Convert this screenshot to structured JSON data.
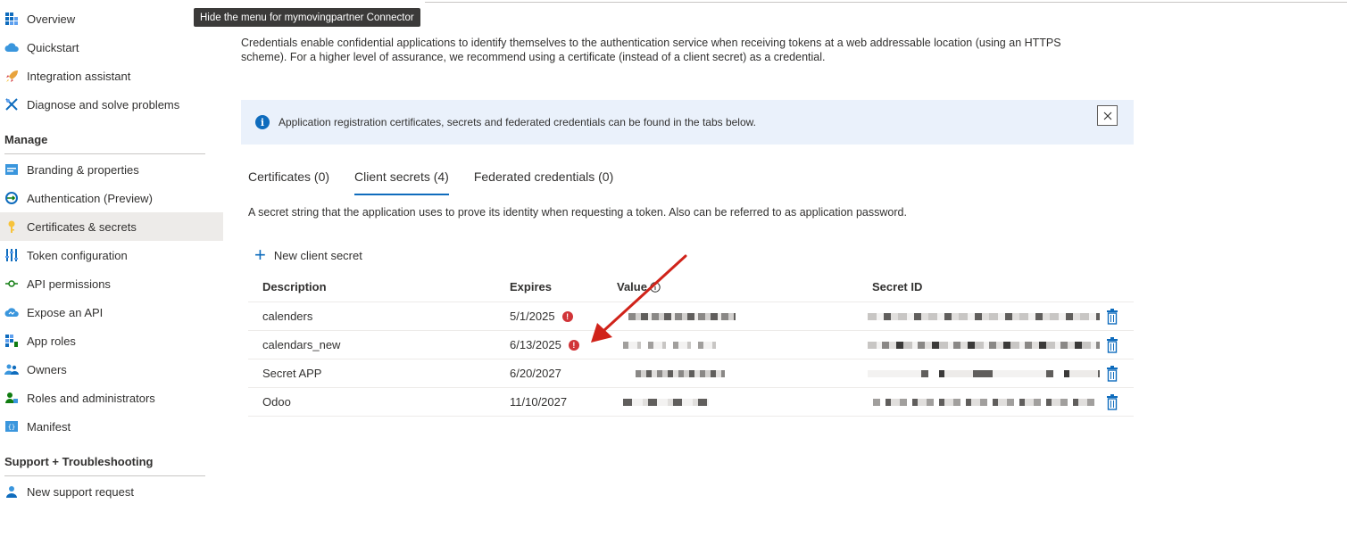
{
  "tooltip": "Hide the menu for mymovingpartner Connector",
  "sidebar": {
    "top_items": [
      {
        "label": "Overview",
        "icon": "overview-grid-icon"
      },
      {
        "label": "Quickstart",
        "icon": "quickstart-cloud-icon"
      },
      {
        "label": "Integration assistant",
        "icon": "rocket-icon"
      },
      {
        "label": "Diagnose and solve problems",
        "icon": "wrench-icon"
      }
    ],
    "manage_heading": "Manage",
    "manage_items": [
      {
        "label": "Branding & properties",
        "icon": "branding-icon"
      },
      {
        "label": "Authentication (Preview)",
        "icon": "authentication-icon"
      },
      {
        "label": "Certificates & secrets",
        "icon": "key-icon",
        "active": true
      },
      {
        "label": "Token configuration",
        "icon": "token-config-icon"
      },
      {
        "label": "API permissions",
        "icon": "api-permissions-icon"
      },
      {
        "label": "Expose an API",
        "icon": "expose-api-cloud-icon"
      },
      {
        "label": "App roles",
        "icon": "app-roles-grid-icon"
      },
      {
        "label": "Owners",
        "icon": "owners-icon"
      },
      {
        "label": "Roles and administrators",
        "icon": "roles-admin-icon"
      },
      {
        "label": "Manifest",
        "icon": "manifest-icon"
      }
    ],
    "support_heading": "Support + Troubleshooting",
    "support_items": [
      {
        "label": "New support request",
        "icon": "support-person-icon"
      }
    ]
  },
  "main": {
    "intro": "Credentials enable confidential applications to identify themselves to the authentication service when receiving tokens at a web addressable location (using an HTTPS scheme). For a higher level of assurance, we recommend using a certificate (instead of a client secret) as a credential.",
    "info_text": "Application registration certificates, secrets and federated credentials can be found in the tabs below.",
    "tabs": [
      {
        "label": "Certificates (0)",
        "active": false
      },
      {
        "label": "Client secrets (4)",
        "active": true
      },
      {
        "label": "Federated credentials (0)",
        "active": false
      }
    ],
    "tab_description": "A secret string that the application uses to prove its identity when requesting a token. Also can be referred to as application password.",
    "new_secret_label": "New client secret",
    "table": {
      "headers": {
        "description": "Description",
        "expires": "Expires",
        "value": "Value",
        "secret_id": "Secret ID"
      },
      "rows": [
        {
          "description": "calenders",
          "expires": "5/1/2025",
          "expired": true
        },
        {
          "description": "calendars_new",
          "expires": "6/13/2025",
          "expired": true
        },
        {
          "description": "Secret APP",
          "expires": "6/20/2027",
          "expired": false
        },
        {
          "description": "Odoo",
          "expires": "11/10/2027",
          "expired": false
        }
      ]
    }
  },
  "colors": {
    "accent": "#0f6cbd",
    "error": "#d13438",
    "arrow": "#d0231a",
    "info_bg": "#eaf1fb",
    "active_nav_bg": "#edebe9"
  }
}
